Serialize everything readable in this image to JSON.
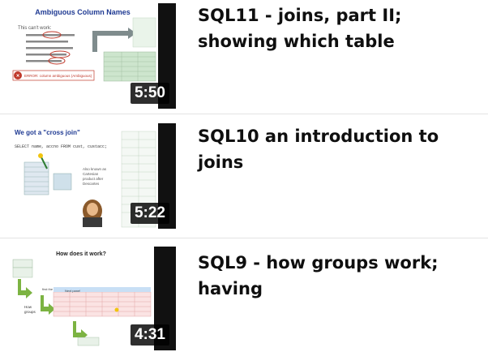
{
  "videos": [
    {
      "title": "SQL11 - joins, part II; showing which table",
      "duration": "5:50",
      "slide_heading": "Ambiguous Column Names",
      "slide_bullet": "This can't work:",
      "slide_error": "ERROR: column ambiguous (Ambiguous)"
    },
    {
      "title": "SQL10 an introduction to joins",
      "duration": "5:22",
      "slide_heading": "We got a \"cross join\"",
      "slide_code": "SELECT name, accno FROM cust, custacc;",
      "slide_note": "Also known as Cartesian product after Descartes"
    },
    {
      "title": "SQL9 - how groups work; having",
      "duration": "4:31",
      "slide_heading": "How does it work?",
      "slide_label": "Step 1: Groups"
    }
  ]
}
